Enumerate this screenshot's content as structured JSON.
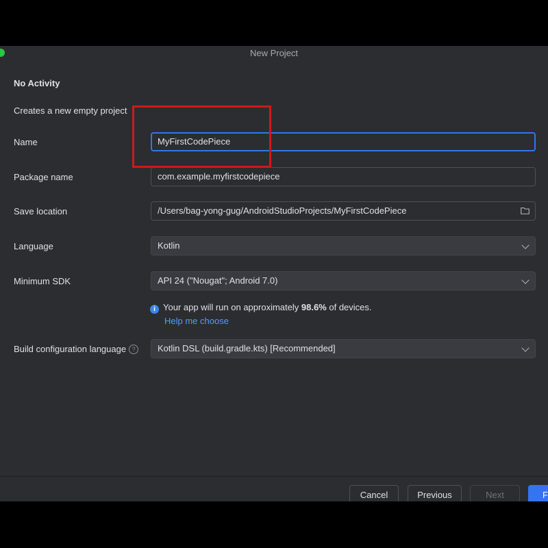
{
  "window": {
    "title": "New Project"
  },
  "template": {
    "title": "No Activity",
    "description": "Creates a new empty project"
  },
  "form": {
    "name": {
      "label": "Name",
      "value": "MyFirstCodePiece"
    },
    "package": {
      "label": "Package name",
      "value": "com.example.myfirstcodepiece"
    },
    "save_location": {
      "label": "Save location",
      "value": "/Users/bag-yong-gug/AndroidStudioProjects/MyFirstCodePiece",
      "icon": "folder-icon"
    },
    "language": {
      "label": "Language",
      "value": "Kotlin"
    },
    "min_sdk": {
      "label": "Minimum SDK",
      "value": "API 24 (\"Nougat\"; Android 7.0)"
    },
    "info": {
      "prefix": "Your app will run on approximately",
      "percent": "98.6%",
      "suffix": "of devices.",
      "link": "Help me choose"
    },
    "build_config": {
      "label": "Build configuration language",
      "value": "Kotlin DSL (build.gradle.kts) [Recommended]"
    }
  },
  "buttons": {
    "cancel": "Cancel",
    "previous": "Previous",
    "next": "Next",
    "finish": "F"
  },
  "colors": {
    "accent": "#3574f0",
    "highlight": "#d0191b",
    "background": "#2b2d30"
  }
}
